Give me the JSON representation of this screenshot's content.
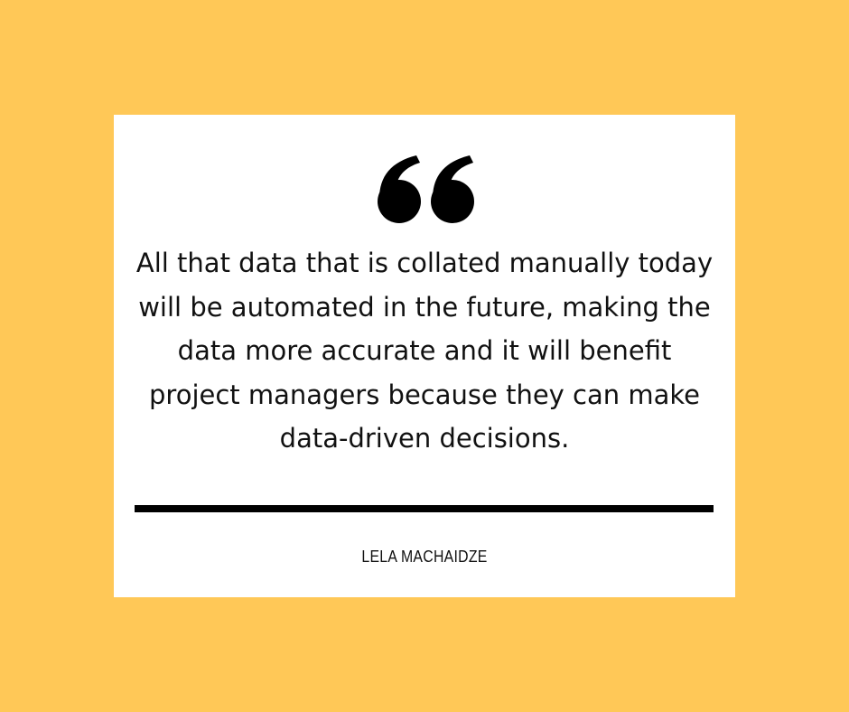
{
  "colors": {
    "background": "#FFC857",
    "card": "#FFFFFF",
    "text": "#111111",
    "rule": "#000000"
  },
  "quote_icon": "open-double-quote-icon",
  "quote": "All that data that is collated manually today will be automated in the future, making the data more accurate and it will benefit project managers because they can make data-driven decisions.",
  "author": "LELA MACHAIDZE"
}
